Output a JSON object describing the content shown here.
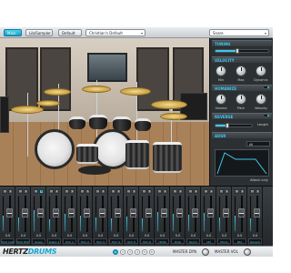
{
  "topbar": {
    "tab_main": "Main",
    "tab_library": "Lib/Sampler",
    "preset_btn": "Default",
    "kit_select": "Christian's Default",
    "style_select": "Snare"
  },
  "panel": {
    "tuning_title": "TUNING",
    "velocity_title": "VELOCITY",
    "vel_knobs": [
      "Min",
      "Max",
      "Dynamic"
    ],
    "humanize_title": "HUMANIZE",
    "hum_knobs": [
      "Volume",
      "Pitch",
      "Velocity"
    ],
    "reverse_title": "REVERSE",
    "reverse_value": "Length",
    "adsr_title": "ADSR",
    "adsr_mode": "All",
    "adsr_note": "Attack only"
  },
  "mixer": {
    "channels": [
      {
        "name": "Kick Left",
        "value": "0.0",
        "level": 0.45
      },
      {
        "name": "Kick Right",
        "value": "0.0",
        "level": 0.4
      },
      {
        "name": "Snare",
        "value": "0.0",
        "level": 0.6
      },
      {
        "name": "Snare 2",
        "value": "0.0",
        "level": 0.35
      },
      {
        "name": "Tom 1",
        "value": "0.0",
        "level": 0.5
      },
      {
        "name": "Tom 2",
        "value": "0.0",
        "level": 0.45
      },
      {
        "name": "Tom 3",
        "value": "0.0",
        "level": 0.4
      },
      {
        "name": "Tom 4",
        "value": "0.0",
        "level": 0.38
      },
      {
        "name": "Tom 5",
        "value": "0.0",
        "level": 0.42
      },
      {
        "name": "Tom 6",
        "value": "0.0",
        "level": 0.36
      },
      {
        "name": "HiHat",
        "value": "0.0",
        "level": 0.55
      },
      {
        "name": "Ride",
        "value": "0.0",
        "level": 0.5
      },
      {
        "name": "Room",
        "value": "0.0",
        "level": 0.48
      },
      {
        "name": "OH",
        "value": "0.0",
        "level": 0.52
      },
      {
        "name": "Mono",
        "value": "0.0",
        "level": 0.4
      },
      {
        "name": "Mix",
        "value": "0.0",
        "level": 0.46
      },
      {
        "name": "Reverb",
        "value": "0.0",
        "level": 0.38
      }
    ]
  },
  "bottombar": {
    "logo_text": "HERTZ",
    "logo_accent": "DRUMS",
    "pages": [
      "1",
      "2",
      "3",
      "4",
      "5",
      "6"
    ],
    "master_dyn": "MASTER DYN",
    "master_vol": "MASTER VOL"
  },
  "colors": {
    "accent": "#3ec7ea",
    "panel_bg": "#2c3033"
  }
}
